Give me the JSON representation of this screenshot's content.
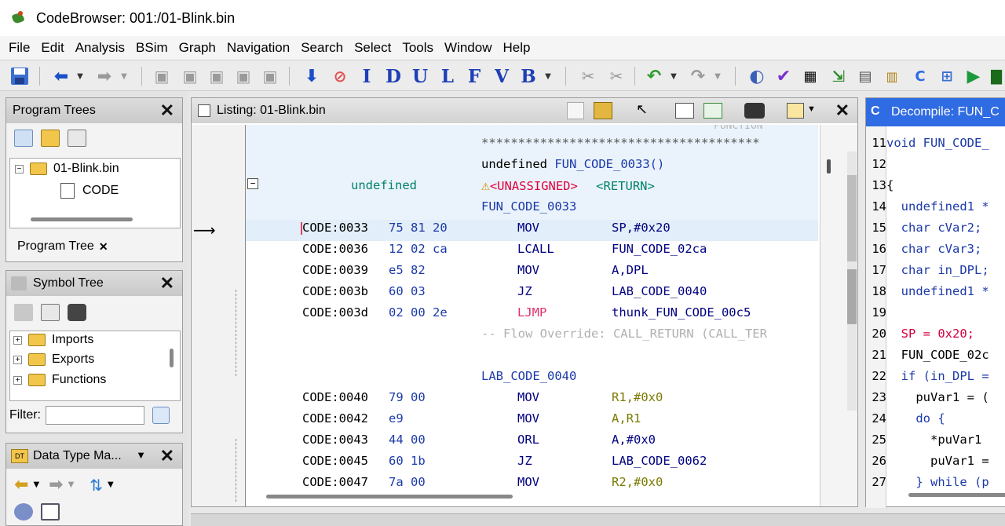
{
  "window": {
    "title": "CodeBrowser: 001:/01-Blink.bin"
  },
  "menu": [
    "File",
    "Edit",
    "Analysis",
    "BSim",
    "Graph",
    "Navigation",
    "Search",
    "Select",
    "Tools",
    "Window",
    "Help"
  ],
  "toolbar": {
    "letters": [
      "I",
      "D",
      "U",
      "L",
      "F",
      "V",
      "B"
    ]
  },
  "program_trees": {
    "title": "Program Trees",
    "root": "01-Blink.bin",
    "child": "CODE",
    "tab_label": "Program Tree"
  },
  "symbol_tree": {
    "title": "Symbol Tree",
    "items": [
      "Imports",
      "Exports",
      "Functions"
    ],
    "filter_label": "Filter:"
  },
  "data_type_manager": {
    "title": "Data Type Ma..."
  },
  "listing": {
    "title": "Listing:  01-Blink.bin",
    "stars": "**************************************",
    "function_label_top": "FUNCTION",
    "signature_type": "undefined",
    "signature_name": "FUN_CODE_0033()",
    "return_type": "undefined",
    "unassigned": "<UNASSIGNED>",
    "return_tag": "<RETURN>",
    "func_label": "FUN_CODE_0033",
    "rows_a": [
      {
        "addr": "CODE:0033",
        "bytes": "75 81 20",
        "mn": "MOV",
        "op": "SP,#0x20"
      },
      {
        "addr": "CODE:0036",
        "bytes": "12 02 ca",
        "mn": "LCALL",
        "op": "FUN_CODE_02ca"
      },
      {
        "addr": "CODE:0039",
        "bytes": "e5 82",
        "mn": "MOV",
        "op": "A,DPL"
      },
      {
        "addr": "CODE:003b",
        "bytes": "60 03",
        "mn": "JZ",
        "op": "LAB_CODE_0040"
      },
      {
        "addr": "CODE:003d",
        "bytes": "02 00 2e",
        "mn": "LJMP",
        "op": "thunk_FUN_CODE_00c5"
      }
    ],
    "flow_override": "-- Flow Override: CALL_RETURN (CALL_TER",
    "label_0040": "LAB_CODE_0040",
    "rows_b": [
      {
        "addr": "CODE:0040",
        "bytes": "79 00",
        "mn": "MOV",
        "op": "R1,#0x0"
      },
      {
        "addr": "CODE:0042",
        "bytes": "e9",
        "mn": "MOV",
        "op": "A,R1"
      },
      {
        "addr": "CODE:0043",
        "bytes": "44 00",
        "mn": "ORL",
        "op": "A,#0x0"
      },
      {
        "addr": "CODE:0045",
        "bytes": "60 1b",
        "mn": "JZ",
        "op": "LAB_CODE_0062"
      },
      {
        "addr": "CODE:0047",
        "bytes": "7a 00",
        "mn": "MOV",
        "op": "R2,#0x0"
      }
    ]
  },
  "decompiler": {
    "title": "Decompile: FUN_C",
    "lines": [
      {
        "n": "11",
        "t": "void FUN_CODE_"
      },
      {
        "n": "12",
        "t": ""
      },
      {
        "n": "13",
        "t": "{"
      },
      {
        "n": "14",
        "t": "  undefined1 *"
      },
      {
        "n": "15",
        "t": "  char cVar2;"
      },
      {
        "n": "16",
        "t": "  char cVar3;"
      },
      {
        "n": "17",
        "t": "  char in_DPL;"
      },
      {
        "n": "18",
        "t": "  undefined1 *"
      },
      {
        "n": "19",
        "t": ""
      },
      {
        "n": "20",
        "t": "  SP = 0x20;"
      },
      {
        "n": "21",
        "t": "  FUN_CODE_02c"
      },
      {
        "n": "22",
        "t": "  if (in_DPL ="
      },
      {
        "n": "23",
        "t": "    puVar1 = ("
      },
      {
        "n": "24",
        "t": "    do {"
      },
      {
        "n": "25",
        "t": "      *puVar1 "
      },
      {
        "n": "26",
        "t": "      puVar1 ="
      },
      {
        "n": "27",
        "t": "    } while (p"
      }
    ]
  }
}
